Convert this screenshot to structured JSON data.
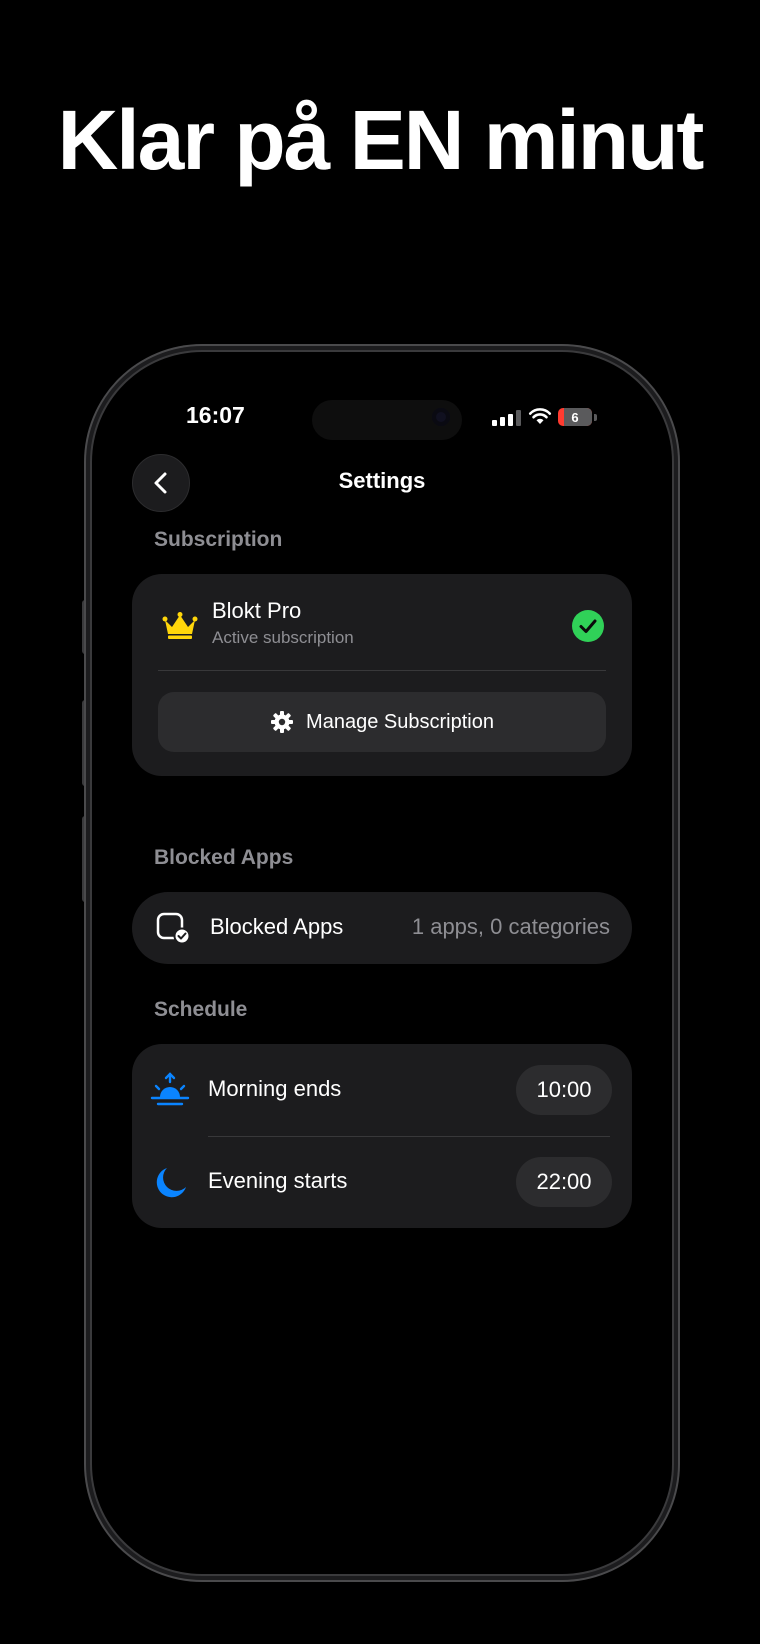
{
  "headline": "Klar på EN minut",
  "status_bar": {
    "time": "16:07",
    "battery_level": "6"
  },
  "nav": {
    "title": "Settings",
    "back_icon": "chevron-left-icon"
  },
  "subscription": {
    "section_label": "Subscription",
    "plan_name": "Blokt Pro",
    "plan_status": "Active subscription",
    "plan_icon": "crown-icon",
    "status_icon": "checkmark-circle-icon",
    "manage_label": "Manage Subscription",
    "manage_icon": "gear-icon"
  },
  "blocked_apps": {
    "section_label": "Blocked Apps",
    "row_label": "Blocked Apps",
    "row_value": "1 apps, 0 categories",
    "icon": "app-check-icon"
  },
  "schedule": {
    "section_label": "Schedule",
    "morning": {
      "label": "Morning ends",
      "time": "10:00",
      "icon": "sunrise-icon"
    },
    "evening": {
      "label": "Evening starts",
      "time": "22:00",
      "icon": "moon-icon"
    }
  },
  "colors": {
    "background": "#000000",
    "card": "#1c1c1e",
    "crown": "#ffd60a",
    "check": "#30d158",
    "schedule_icon": "#0a84ff",
    "section_label": "#8e8e93"
  }
}
